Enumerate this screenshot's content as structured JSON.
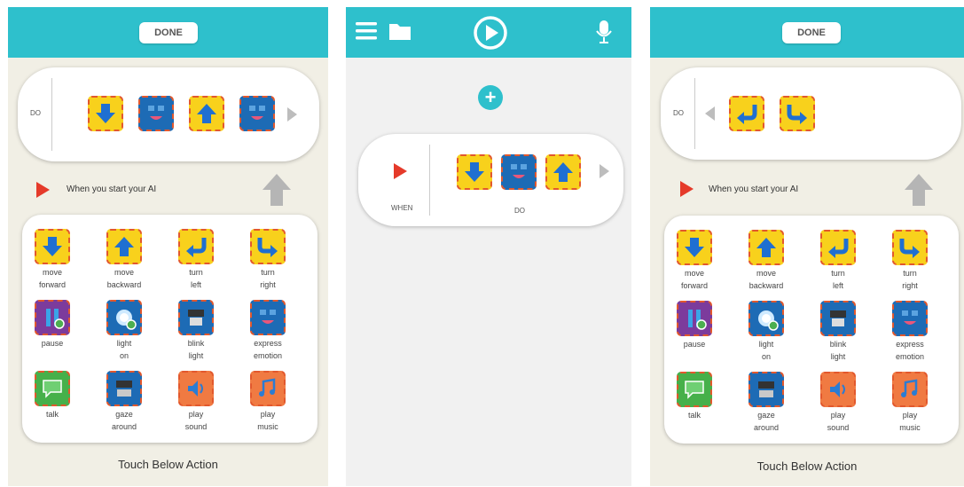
{
  "colors": {
    "teal": "#2ec0cc",
    "red": "#e53a2a",
    "yellow_block": "#f8d11c",
    "blue_block": "#1d6bb5"
  },
  "left_panel": {
    "done_label": "DONE",
    "do_label": "DO",
    "sequence": [
      {
        "kind": "move-forward",
        "icon": "arrow-down-icon"
      },
      {
        "kind": "express-emotion",
        "icon": "face-icon"
      },
      {
        "kind": "move-backward",
        "icon": "arrow-up-icon"
      },
      {
        "kind": "express-emotion",
        "icon": "face-icon"
      }
    ],
    "trigger_label": "When you start your AI",
    "touch_label": "Touch Below Action"
  },
  "center_panel": {
    "when_label": "WHEN",
    "do_label": "DO",
    "sequence": [
      {
        "kind": "move-forward",
        "icon": "arrow-down-icon"
      },
      {
        "kind": "express-emotion",
        "icon": "face-icon"
      },
      {
        "kind": "move-backward",
        "icon": "arrow-up-icon"
      }
    ]
  },
  "right_panel": {
    "done_label": "DONE",
    "do_label": "DO",
    "sequence": [
      {
        "kind": "turn-left",
        "icon": "turn-left-icon"
      },
      {
        "kind": "turn-right",
        "icon": "turn-right-icon"
      }
    ],
    "trigger_label": "When you start your AI",
    "touch_label": "Touch Below Action"
  },
  "palette": [
    {
      "line1": "move",
      "line2": "forward",
      "color": "y",
      "icon": "arrow-down-icon"
    },
    {
      "line1": "move",
      "line2": "backward",
      "color": "y",
      "icon": "arrow-up-icon"
    },
    {
      "line1": "turn",
      "line2": "left",
      "color": "y",
      "icon": "turn-left-icon"
    },
    {
      "line1": "turn",
      "line2": "right",
      "color": "y",
      "icon": "turn-right-icon"
    },
    {
      "line1": "pause",
      "line2": "",
      "color": "p",
      "icon": "pause-icon"
    },
    {
      "line1": "light",
      "line2": "on",
      "color": "b",
      "icon": "light-icon"
    },
    {
      "line1": "blink",
      "line2": "light",
      "color": "b",
      "icon": "blink-icon"
    },
    {
      "line1": "express",
      "line2": "emotion",
      "color": "b",
      "icon": "face-icon"
    },
    {
      "line1": "talk",
      "line2": "",
      "color": "g",
      "icon": "speech-icon"
    },
    {
      "line1": "gaze",
      "line2": "around",
      "color": "b",
      "icon": "gaze-icon"
    },
    {
      "line1": "play",
      "line2": "sound",
      "color": "o",
      "icon": "speaker-icon"
    },
    {
      "line1": "play",
      "line2": "music",
      "color": "o",
      "icon": "music-icon"
    }
  ]
}
